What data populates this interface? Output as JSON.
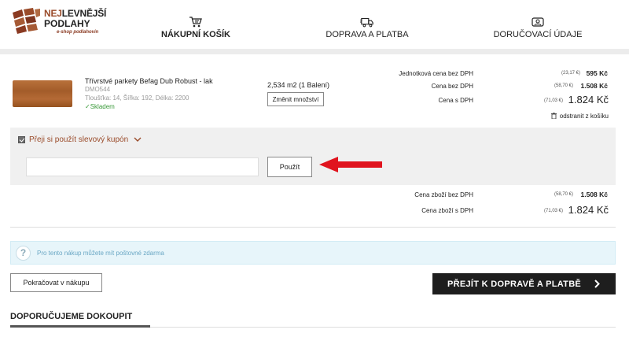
{
  "logo": {
    "line1_accent": "NEJ",
    "line1_rest": "LEVNĚJŠÍ",
    "line2": "PODLAHY",
    "tagline": "e-shop podlahovin"
  },
  "steps": [
    {
      "label": "NÁKUPNÍ KOŠÍK",
      "icon": "cart-icon",
      "active": true
    },
    {
      "label": "DOPRAVA A PLATBA",
      "icon": "truck-icon",
      "active": false
    },
    {
      "label": "DORUČOVACÍ ÚDAJE",
      "icon": "id-card-icon",
      "active": false
    }
  ],
  "product": {
    "name": "Třívrstvé parkety Befag Dub Robust - lak",
    "code": "DMO544",
    "dimensions": "Tloušťka: 14, Šířka: 192, Délka: 2200",
    "stock": "Skladem",
    "quantity": "2,534 m2 (1 Balení)",
    "change_qty_label": "Změnit množství",
    "unit_price_label": "Jednotková cena bez DPH",
    "unit_price_eur": "(23,17 €)",
    "unit_price": "595 Kč",
    "price_excl_label": "Cena bez DPH",
    "price_excl_eur": "(58,70 €)",
    "price_excl": "1.508 Kč",
    "price_incl_label": "Cena s DPH",
    "price_incl_eur": "(71,03 €)",
    "price_incl": "1.824 Kč",
    "remove_label": "odstranit z košíku"
  },
  "coupon": {
    "label": "Přeji si použít slevový kupón",
    "checked": true,
    "input_value": "",
    "apply_label": "Použít"
  },
  "totals": {
    "excl_label": "Cena zboží bez DPH",
    "excl_eur": "(58,70 €)",
    "excl": "1.508 Kč",
    "incl_label": "Cena zboží s DPH",
    "incl_eur": "(71,03 €)",
    "incl": "1.824 Kč"
  },
  "info": {
    "text": "Pro tento nákup můžete mít poštovné zdarma"
  },
  "actions": {
    "continue_label": "Pokračovat v nákupu",
    "checkout_label": "PŘEJÍT K DOPRAVĚ A PLATBĚ"
  },
  "recommend": {
    "title": "DOPORUČUJEME DOKOUPIT"
  },
  "colors": {
    "brand": "#9a4b2a",
    "stock_green": "#3a9a3a",
    "info_bg": "#e7f5fa",
    "info_text": "#6aa7c4",
    "checkout_bg": "#1e1e1e",
    "arrow_red": "#e0141e"
  }
}
